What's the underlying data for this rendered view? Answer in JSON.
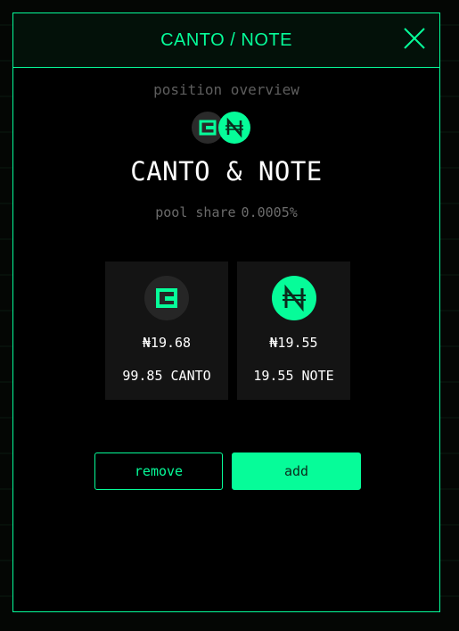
{
  "colors": {
    "accent": "#06fc99",
    "panel": "#141414",
    "text": "#ffffff",
    "muted": "#6b6b6b"
  },
  "modal": {
    "title": "CANTO / NOTE",
    "close_icon": "close-icon"
  },
  "overview": {
    "label": "position overview",
    "pair_title": "CANTO & NOTE",
    "pool_share_label": "pool share",
    "pool_share_value": "0.0005%"
  },
  "tokens": [
    {
      "symbol": "CANTO",
      "icon": "canto-logo-icon",
      "value": "₦19.68",
      "amount": "99.85 CANTO"
    },
    {
      "symbol": "NOTE",
      "icon": "note-logo-icon",
      "value": "₦19.55",
      "amount": "19.55 NOTE"
    }
  ],
  "actions": {
    "remove_label": "remove",
    "add_label": "add"
  }
}
